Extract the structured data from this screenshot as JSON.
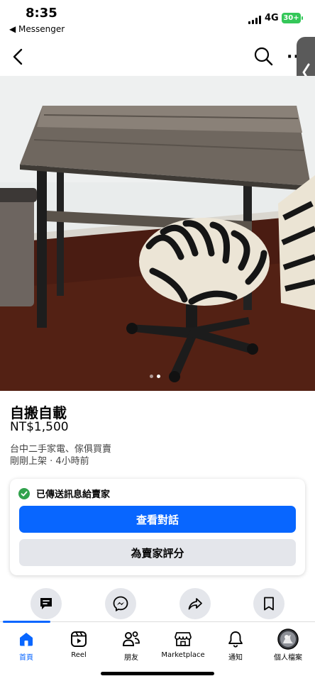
{
  "status_bar": {
    "time": "8:35",
    "back_app": "◀ Messenger",
    "network": "4G",
    "battery": "30+"
  },
  "nav": {
    "back_icon": "chevron-left-icon",
    "search_icon": "search-icon",
    "more_icon": "more-icon"
  },
  "photo": {
    "description_icon": "listing-photo",
    "page_count": 2,
    "current_page": 2
  },
  "listing": {
    "title": "自搬自載",
    "price": "NT$1,500",
    "location": "台中二手家電、傢俱買賣",
    "listed": "剛剛上架 · 4小時前"
  },
  "message_card": {
    "sent_text": "已傳送訊息給賣家",
    "view_chat": "查看對話",
    "rate_seller": "為賣家評分"
  },
  "actions": [
    {
      "name": "message-seller",
      "icon": "chat-bubble-icon"
    },
    {
      "name": "messenger",
      "icon": "messenger-icon"
    },
    {
      "name": "share",
      "icon": "share-icon"
    },
    {
      "name": "save",
      "icon": "bookmark-icon"
    }
  ],
  "tabbar": {
    "items": [
      {
        "label": "首頁",
        "icon": "home-icon",
        "active": true
      },
      {
        "label": "Reel",
        "icon": "reel-icon",
        "active": false
      },
      {
        "label": "朋友",
        "icon": "friends-icon",
        "active": false
      },
      {
        "label": "Marketplace",
        "icon": "marketplace-icon",
        "active": false
      },
      {
        "label": "通知",
        "icon": "bell-icon",
        "active": false
      },
      {
        "label": "個人檔案",
        "icon": "avatar",
        "active": false
      }
    ]
  },
  "colors": {
    "accent": "#0866ff",
    "success": "#31a24c",
    "secondary_button": "#e4e6eb"
  }
}
